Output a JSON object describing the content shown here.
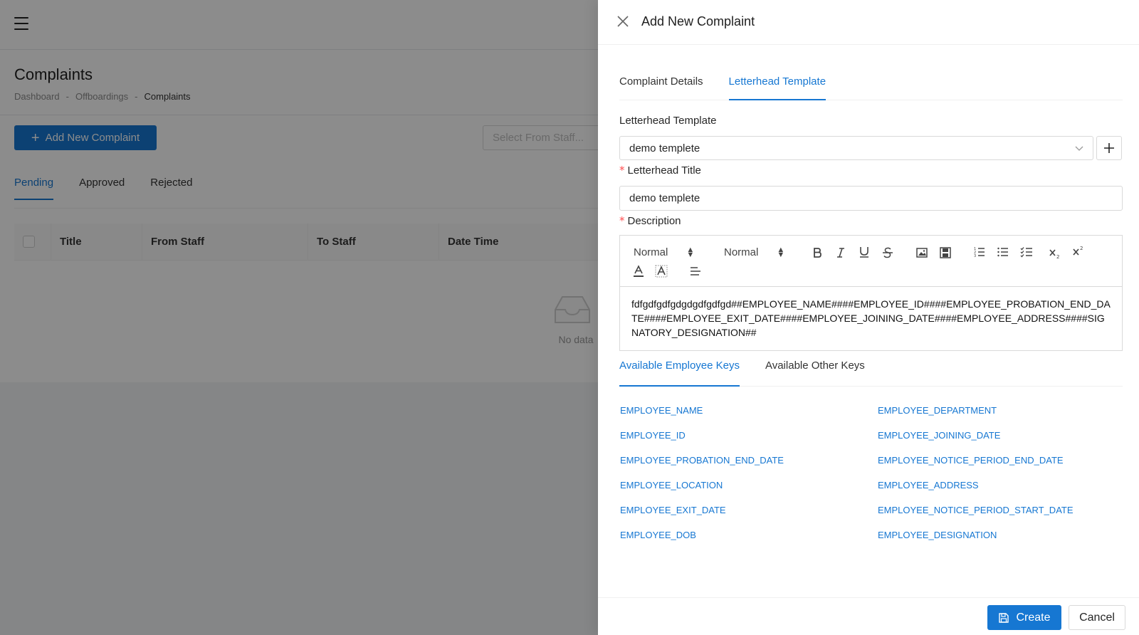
{
  "background": {
    "page_title": "Complaints",
    "breadcrumb": {
      "items": [
        "Dashboard",
        "Offboardings",
        "Complaints"
      ],
      "separator": "-"
    },
    "add_button_label": "Add New Complaint",
    "staff_select_placeholder": "Select From Staff...",
    "tabs": [
      {
        "label": "Pending",
        "active": true
      },
      {
        "label": "Approved",
        "active": false
      },
      {
        "label": "Rejected",
        "active": false
      }
    ],
    "table": {
      "columns": [
        "Title",
        "From Staff",
        "To Staff",
        "Date Time"
      ],
      "empty_text": "No data"
    }
  },
  "drawer": {
    "title": "Add New Complaint",
    "tabs": [
      {
        "label": "Complaint Details",
        "active": false
      },
      {
        "label": "Letterhead Template",
        "active": true
      }
    ],
    "letterhead_template": {
      "label": "Letterhead Template",
      "selected_value": "demo templete"
    },
    "letterhead_title": {
      "label": "Letterhead Title",
      "value": "demo templete",
      "required_marker": "*"
    },
    "description": {
      "label": "Description",
      "required_marker": "*",
      "toolbar": {
        "header_select": "Normal",
        "size_select": "Normal"
      },
      "content": "fdfgdfgdfgdgdgdfgdfgd##EMPLOYEE_NAME####EMPLOYEE_ID####EMPLOYEE_PROBATION_END_DATE####EMPLOYEE_EXIT_DATE####EMPLOYEE_JOINING_DATE####EMPLOYEE_ADDRESS####SIGNATORY_DESIGNATION##"
    },
    "key_tabs": [
      {
        "label": "Available Employee Keys",
        "active": true
      },
      {
        "label": "Available Other Keys",
        "active": false
      }
    ],
    "employee_keys": [
      "EMPLOYEE_NAME",
      "EMPLOYEE_DEPARTMENT",
      "EMPLOYEE_ID",
      "EMPLOYEE_JOINING_DATE",
      "EMPLOYEE_PROBATION_END_DATE",
      "EMPLOYEE_NOTICE_PERIOD_END_DATE",
      "EMPLOYEE_LOCATION",
      "EMPLOYEE_ADDRESS",
      "EMPLOYEE_EXIT_DATE",
      "EMPLOYEE_NOTICE_PERIOD_START_DATE",
      "EMPLOYEE_DOB",
      "EMPLOYEE_DESIGNATION"
    ],
    "footer": {
      "create_label": "Create",
      "cancel_label": "Cancel"
    }
  },
  "colors": {
    "primary": "#1677d2",
    "required": "#ff4d4f",
    "overlay": "rgba(0,0,0,0.45)"
  }
}
